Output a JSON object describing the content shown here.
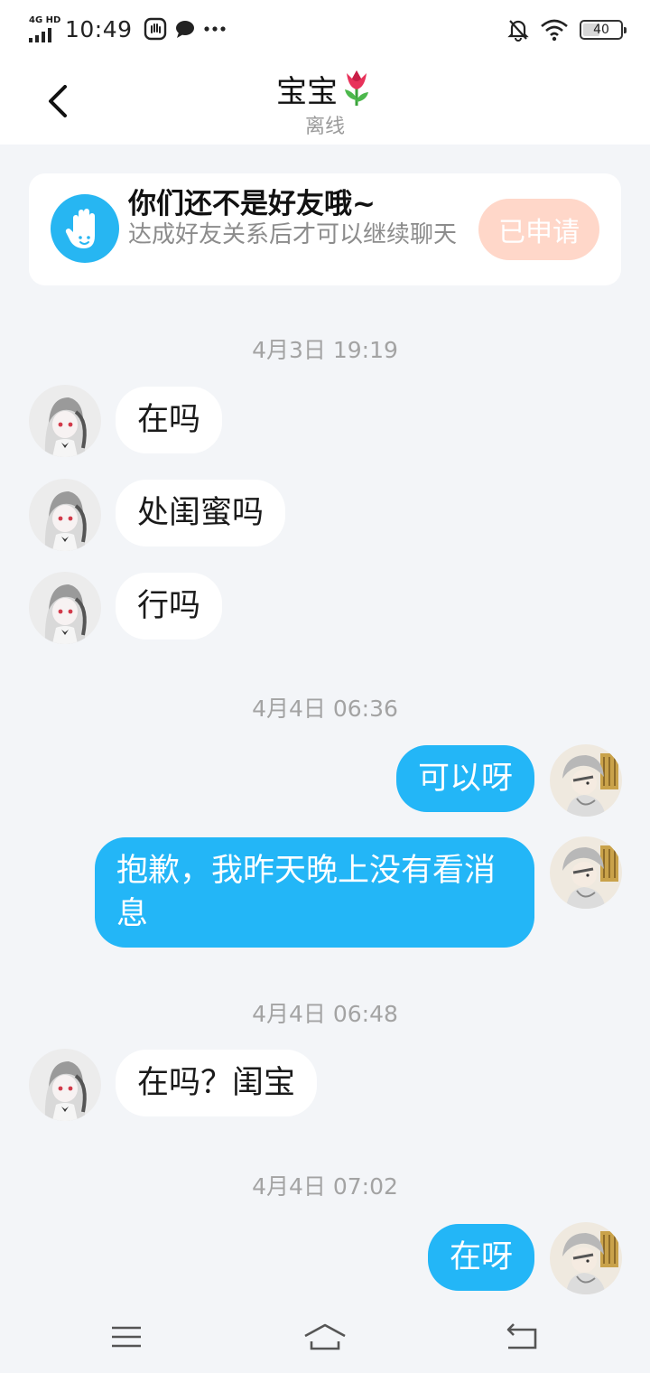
{
  "status_bar": {
    "network": "4G HD",
    "time": "10:49",
    "battery": "40",
    "icons": [
      "hand-notification-icon",
      "chat-bubble-icon",
      "more-dots-icon",
      "bell-off-icon",
      "wifi-icon",
      "battery-icon"
    ]
  },
  "header": {
    "title": "宝宝",
    "title_icon": "tulip-emoji-icon",
    "status": "离线"
  },
  "friend_card": {
    "title": "你们还不是好友哦~",
    "desc": "达成好友关系后才可以继续聊天",
    "button": "已申请",
    "button_color": "#ffd7c9",
    "icon_color": "#27b6f2"
  },
  "timestamps": [
    "4月3日 19:19",
    "4月4日 06:36",
    "4月4日 06:48",
    "4月4日 07:02"
  ],
  "messages": [
    {
      "from": "other",
      "text": "在吗"
    },
    {
      "from": "other",
      "text": "处闺蜜吗"
    },
    {
      "from": "other",
      "text": "行吗"
    },
    {
      "from": "me",
      "text": "可以呀"
    },
    {
      "from": "me",
      "text": "抱歉，我昨天晚上没有看消息"
    },
    {
      "from": "other",
      "text": "在吗？闺宝"
    },
    {
      "from": "me",
      "text": "在呀"
    }
  ],
  "colors": {
    "background": "#f3f5f8",
    "outgoing_bubble": "#23b6f7",
    "incoming_bubble": "#ffffff"
  },
  "nav": {
    "icons": [
      "menu-icon",
      "home-icon",
      "back-icon"
    ]
  }
}
